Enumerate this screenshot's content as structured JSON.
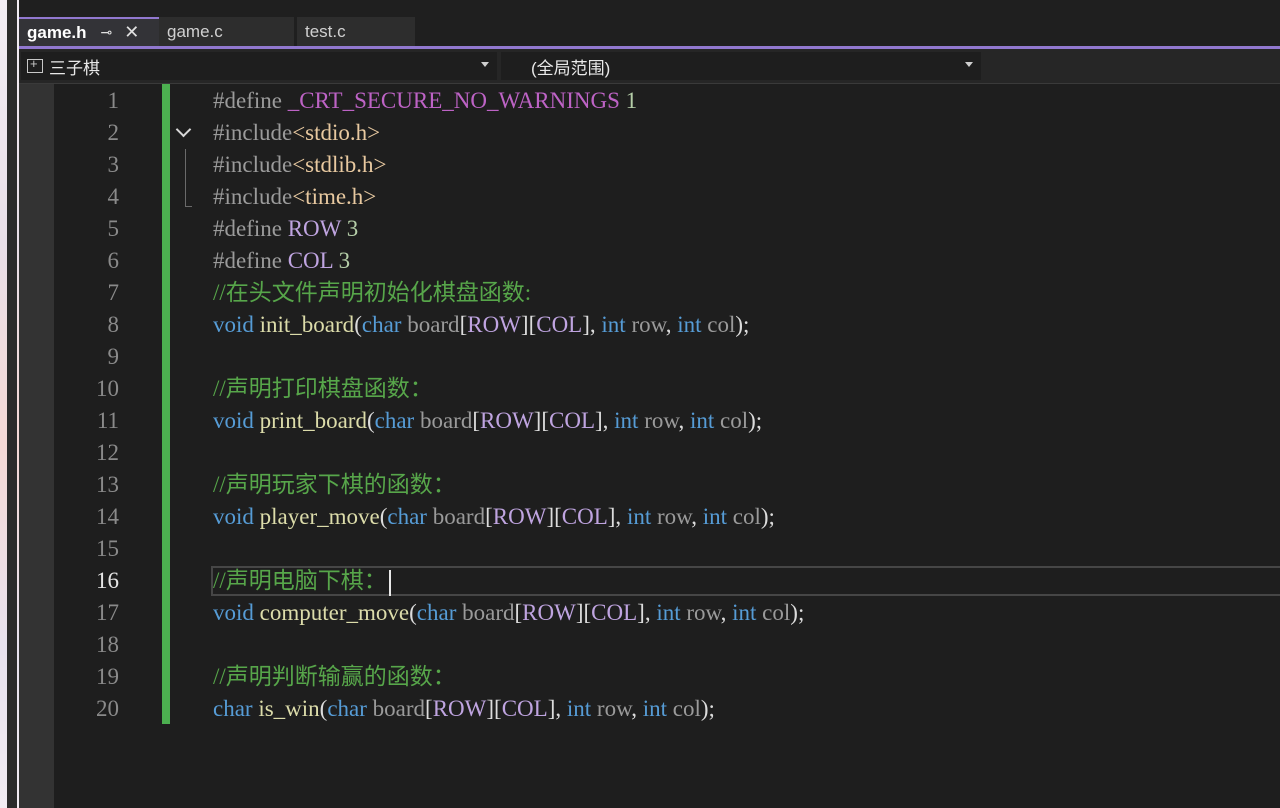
{
  "tabs": [
    {
      "label": "game.h",
      "active": true
    },
    {
      "label": "game.c",
      "active": false
    },
    {
      "label": "test.c",
      "active": false
    }
  ],
  "tab_icons": {
    "pin": "pin-icon",
    "close": "close-icon"
  },
  "nav": {
    "project": "三子棋",
    "scope": "(全局范围)"
  },
  "editor": {
    "current_line": 16,
    "lines": [
      {
        "n": "1",
        "tokens": [
          [
            "pre",
            "#define "
          ],
          [
            "macro",
            "_CRT_SECURE_NO_WARNINGS"
          ],
          [
            "num",
            " 1"
          ]
        ]
      },
      {
        "n": "2",
        "tokens": [
          [
            "pre",
            "#include"
          ],
          [
            "str",
            "<stdio.h>"
          ]
        ]
      },
      {
        "n": "3",
        "tokens": [
          [
            "pre",
            "#include"
          ],
          [
            "str",
            "<stdlib.h>"
          ]
        ]
      },
      {
        "n": "4",
        "tokens": [
          [
            "pre",
            "#include"
          ],
          [
            "str",
            "<time.h>"
          ]
        ]
      },
      {
        "n": "5",
        "tokens": [
          [
            "pre",
            "#define "
          ],
          [
            "def",
            "ROW"
          ],
          [
            "num",
            " 3"
          ]
        ]
      },
      {
        "n": "6",
        "tokens": [
          [
            "pre",
            "#define "
          ],
          [
            "def",
            "COL"
          ],
          [
            "num",
            " 3"
          ]
        ]
      },
      {
        "n": "7",
        "tokens": [
          [
            "cmt",
            "//在头文件声明初始化棋盘函数:"
          ]
        ]
      },
      {
        "n": "8",
        "tokens": [
          [
            "kw",
            "void"
          ],
          [
            "punc",
            " "
          ],
          [
            "fn",
            "init_board"
          ],
          [
            "punc",
            "("
          ],
          [
            "kw",
            "char"
          ],
          [
            "punc",
            " "
          ],
          [
            "param",
            "board"
          ],
          [
            "punc",
            "["
          ],
          [
            "def",
            "ROW"
          ],
          [
            "punc",
            "]["
          ],
          [
            "def",
            "COL"
          ],
          [
            "punc",
            "], "
          ],
          [
            "kw",
            "int"
          ],
          [
            "punc",
            " "
          ],
          [
            "param",
            "row"
          ],
          [
            "punc",
            ", "
          ],
          [
            "kw",
            "int"
          ],
          [
            "punc",
            " "
          ],
          [
            "param",
            "col"
          ],
          [
            "punc",
            ");"
          ]
        ]
      },
      {
        "n": "9",
        "tokens": []
      },
      {
        "n": "10",
        "tokens": [
          [
            "cmt",
            "//声明打印棋盘函数："
          ]
        ]
      },
      {
        "n": "11",
        "tokens": [
          [
            "kw",
            "void"
          ],
          [
            "punc",
            " "
          ],
          [
            "fn",
            "print_board"
          ],
          [
            "punc",
            "("
          ],
          [
            "kw",
            "char"
          ],
          [
            "punc",
            " "
          ],
          [
            "param",
            "board"
          ],
          [
            "punc",
            "["
          ],
          [
            "def",
            "ROW"
          ],
          [
            "punc",
            "]["
          ],
          [
            "def",
            "COL"
          ],
          [
            "punc",
            "], "
          ],
          [
            "kw",
            "int"
          ],
          [
            "punc",
            " "
          ],
          [
            "param",
            "row"
          ],
          [
            "punc",
            ", "
          ],
          [
            "kw",
            "int"
          ],
          [
            "punc",
            " "
          ],
          [
            "param",
            "col"
          ],
          [
            "punc",
            ");"
          ]
        ]
      },
      {
        "n": "12",
        "tokens": []
      },
      {
        "n": "13",
        "tokens": [
          [
            "cmt",
            "//声明玩家下棋的函数："
          ]
        ]
      },
      {
        "n": "14",
        "tokens": [
          [
            "kw",
            "void"
          ],
          [
            "punc",
            " "
          ],
          [
            "fn",
            "player_move"
          ],
          [
            "punc",
            "("
          ],
          [
            "kw",
            "char"
          ],
          [
            "punc",
            " "
          ],
          [
            "param",
            "board"
          ],
          [
            "punc",
            "["
          ],
          [
            "def",
            "ROW"
          ],
          [
            "punc",
            "]["
          ],
          [
            "def",
            "COL"
          ],
          [
            "punc",
            "], "
          ],
          [
            "kw",
            "int"
          ],
          [
            "punc",
            " "
          ],
          [
            "param",
            "row"
          ],
          [
            "punc",
            ", "
          ],
          [
            "kw",
            "int"
          ],
          [
            "punc",
            " "
          ],
          [
            "param",
            "col"
          ],
          [
            "punc",
            ");"
          ]
        ]
      },
      {
        "n": "15",
        "tokens": []
      },
      {
        "n": "16",
        "tokens": [
          [
            "cmt",
            "//声明电脑下棋："
          ]
        ]
      },
      {
        "n": "17",
        "tokens": [
          [
            "kw",
            "void"
          ],
          [
            "punc",
            " "
          ],
          [
            "fn",
            "computer_move"
          ],
          [
            "punc",
            "("
          ],
          [
            "kw",
            "char"
          ],
          [
            "punc",
            " "
          ],
          [
            "param",
            "board"
          ],
          [
            "punc",
            "["
          ],
          [
            "def",
            "ROW"
          ],
          [
            "punc",
            "]["
          ],
          [
            "def",
            "COL"
          ],
          [
            "punc",
            "], "
          ],
          [
            "kw",
            "int"
          ],
          [
            "punc",
            " "
          ],
          [
            "param",
            "row"
          ],
          [
            "punc",
            ", "
          ],
          [
            "kw",
            "int"
          ],
          [
            "punc",
            " "
          ],
          [
            "param",
            "col"
          ],
          [
            "punc",
            ");"
          ]
        ]
      },
      {
        "n": "18",
        "tokens": []
      },
      {
        "n": "19",
        "tokens": [
          [
            "cmt",
            "//声明判断输赢的函数："
          ]
        ]
      },
      {
        "n": "20",
        "tokens": [
          [
            "kw",
            "char"
          ],
          [
            "punc",
            " "
          ],
          [
            "fn",
            "is_win"
          ],
          [
            "punc",
            "("
          ],
          [
            "kw",
            "char"
          ],
          [
            "punc",
            " "
          ],
          [
            "param",
            "board"
          ],
          [
            "punc",
            "["
          ],
          [
            "def",
            "ROW"
          ],
          [
            "punc",
            "]["
          ],
          [
            "def",
            "COL"
          ],
          [
            "punc",
            "], "
          ],
          [
            "kw",
            "int"
          ],
          [
            "punc",
            " "
          ],
          [
            "param",
            "row"
          ],
          [
            "punc",
            ", "
          ],
          [
            "kw",
            "int"
          ],
          [
            "punc",
            " "
          ],
          [
            "param",
            "col"
          ],
          [
            "punc",
            ");"
          ]
        ]
      }
    ]
  }
}
